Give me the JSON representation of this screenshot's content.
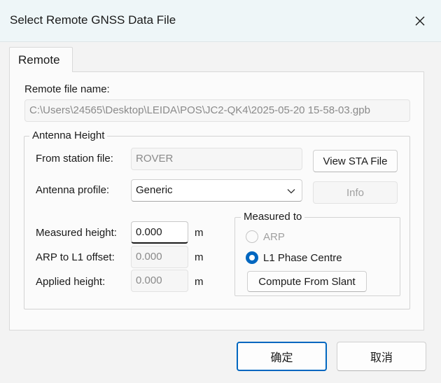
{
  "window": {
    "title": "Select Remote GNSS Data File"
  },
  "tabs": [
    {
      "label": "Remote"
    }
  ],
  "remote_file": {
    "label": "Remote file name:",
    "value": "C:\\Users\\24565\\Desktop\\LEIDA\\POS\\JC2-QK4\\2025-05-20 15-58-03.gpb"
  },
  "antenna": {
    "group_title": "Antenna Height",
    "from_station_label": "From station file:",
    "from_station_value": "ROVER",
    "view_sta_button": "View STA File",
    "profile_label": "Antenna profile:",
    "profile_value": "Generic",
    "info_button": "Info",
    "measured_height_label": "Measured height:",
    "measured_height_value": "0.000",
    "arp_offset_label": "ARP to L1 offset:",
    "arp_offset_value": "0.000",
    "applied_height_label": "Applied height:",
    "applied_height_value": "0.000",
    "unit": "m"
  },
  "measured_to": {
    "group_title": "Measured to",
    "options": [
      {
        "label": "ARP",
        "selected": false,
        "enabled": false
      },
      {
        "label": "L1 Phase Centre",
        "selected": true,
        "enabled": true
      }
    ],
    "compute_button": "Compute From Slant"
  },
  "footer": {
    "ok_label": "确定",
    "cancel_label": "取消"
  },
  "colors": {
    "accent": "#0067c0",
    "titlebar": "#eef6f8",
    "dialog_bg": "#f3f3f3"
  }
}
